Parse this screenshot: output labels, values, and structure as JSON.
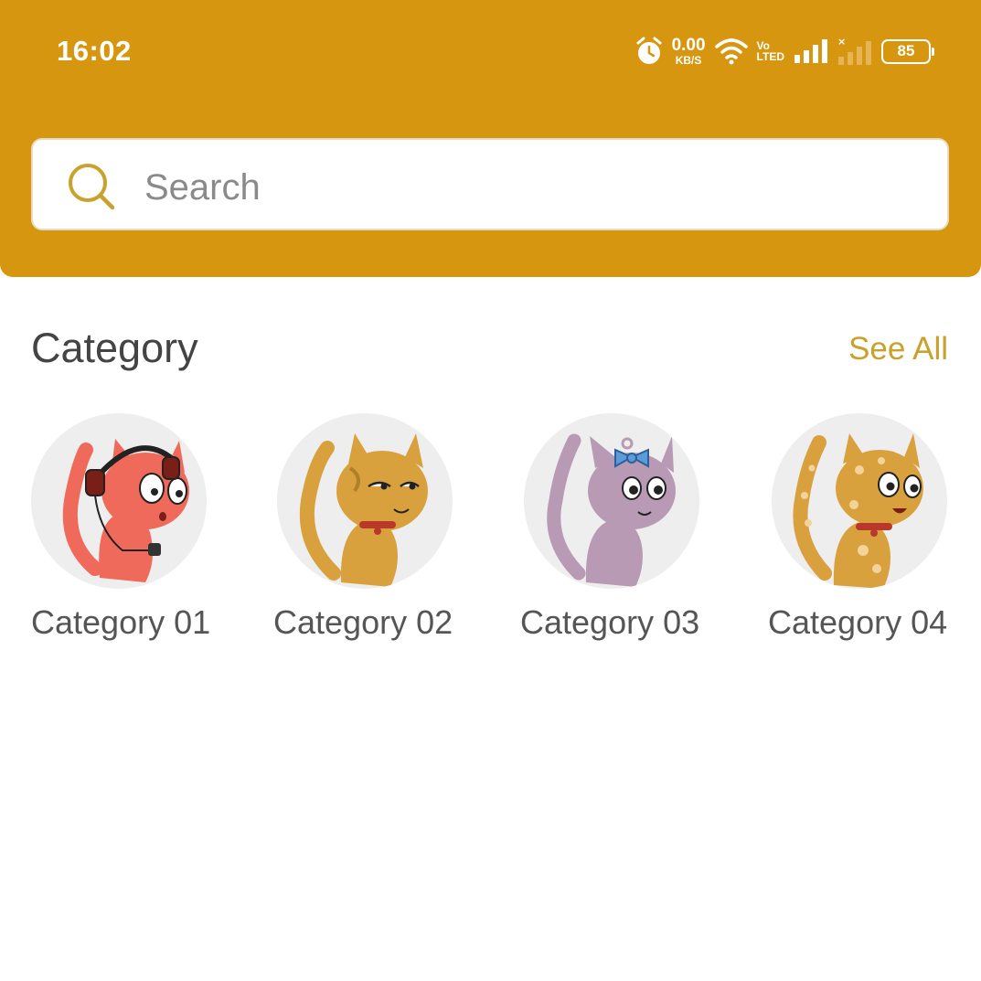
{
  "status_bar": {
    "time": "16:02",
    "net_speed_value": "0.00",
    "net_speed_unit": "KB/S",
    "volte_top": "Vo",
    "volte_bottom": "LTED",
    "battery": "85",
    "icons": [
      "alarm-icon",
      "wifi-icon",
      "signal-icon",
      "signal-no-service-icon",
      "battery-icon"
    ]
  },
  "search": {
    "placeholder": "Search"
  },
  "category_section": {
    "title": "Category",
    "see_all": "See All",
    "items": [
      {
        "label": "Category 01",
        "color": "#EF6A5A",
        "accent": "headphones"
      },
      {
        "label": "Category 02",
        "color": "#D9A13E",
        "accent": "collar"
      },
      {
        "label": "Category 03",
        "color": "#B89AB5",
        "accent": "bow"
      },
      {
        "label": "Category 04",
        "color": "#D9A13E",
        "accent": "spots"
      }
    ]
  },
  "colors": {
    "header": "#D6960F",
    "accent": "#C9A12C",
    "title_text": "#444444",
    "label_text": "#555555"
  }
}
